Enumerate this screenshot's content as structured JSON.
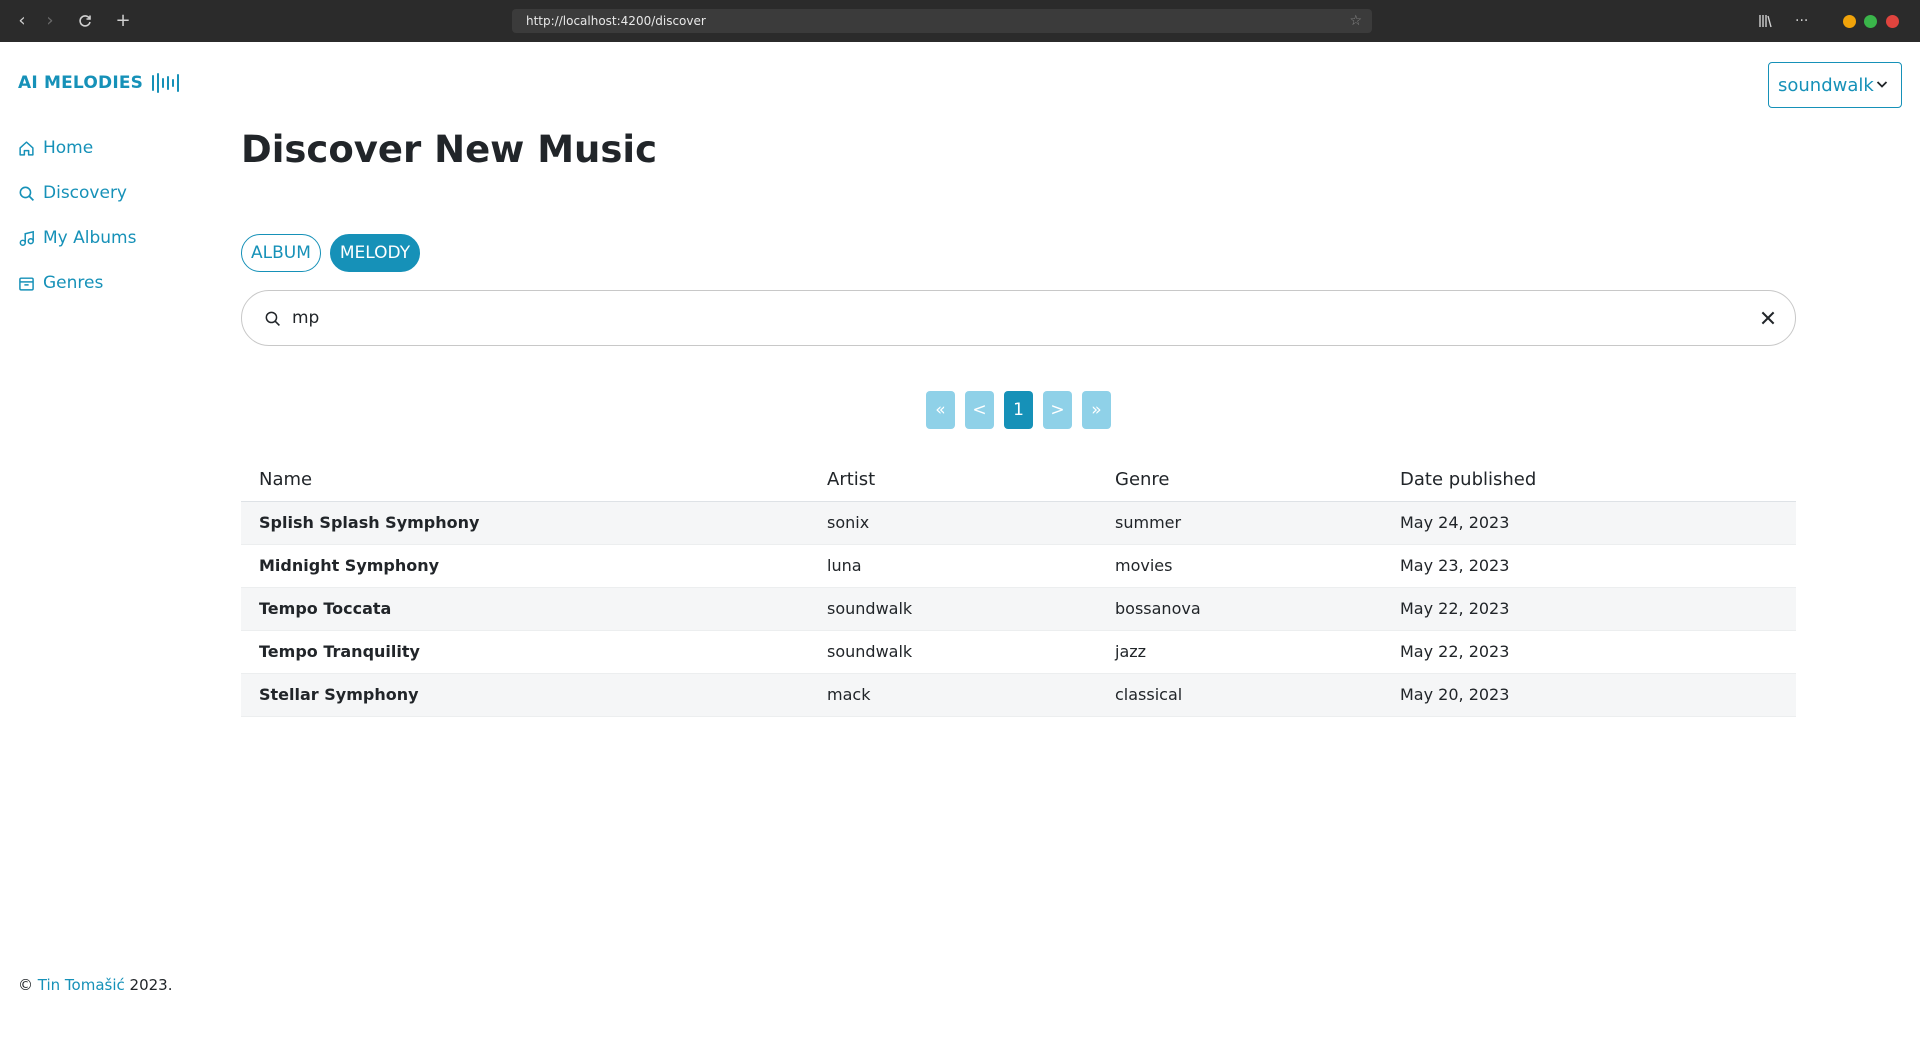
{
  "browser": {
    "url": "http://localhost:4200/discover"
  },
  "app": {
    "brand": "AI MELODIES",
    "user": "soundwalk"
  },
  "sidebar": {
    "items": [
      {
        "label": "Home",
        "icon": "home-icon"
      },
      {
        "label": "Discovery",
        "icon": "search-icon"
      },
      {
        "label": "My Albums",
        "icon": "music-note-icon"
      },
      {
        "label": "Genres",
        "icon": "archive-icon"
      }
    ]
  },
  "main": {
    "title": "Discover New Music",
    "toggles": [
      {
        "label": "ALBUM",
        "active": false
      },
      {
        "label": "MELODY",
        "active": true
      }
    ],
    "search": {
      "value": "mp"
    },
    "pagination": {
      "first": "«",
      "prev": "<",
      "current": "1",
      "next": ">",
      "last": "»"
    },
    "table": {
      "columns": [
        "Name",
        "Artist",
        "Genre",
        "Date published"
      ],
      "rows": [
        {
          "name": "Splish Splash Symphony",
          "artist": "sonix",
          "genre": "summer",
          "date": "May 24, 2023"
        },
        {
          "name": "Midnight Symphony",
          "artist": "luna",
          "genre": "movies",
          "date": "May 23, 2023"
        },
        {
          "name": "Tempo Toccata",
          "artist": "soundwalk",
          "genre": "bossanova",
          "date": "May 22, 2023"
        },
        {
          "name": "Tempo Tranquility",
          "artist": "soundwalk",
          "genre": "jazz",
          "date": "May 22, 2023"
        },
        {
          "name": "Stellar Symphony",
          "artist": "mack",
          "genre": "classical",
          "date": "May 20, 2023"
        }
      ]
    }
  },
  "footer": {
    "copyright": "©",
    "author": "Tin Tomašić",
    "year": "2023."
  },
  "colors": {
    "accent": "#1691b8",
    "accent_light": "#8fd1e8",
    "chrome": "#2b2b2b"
  }
}
